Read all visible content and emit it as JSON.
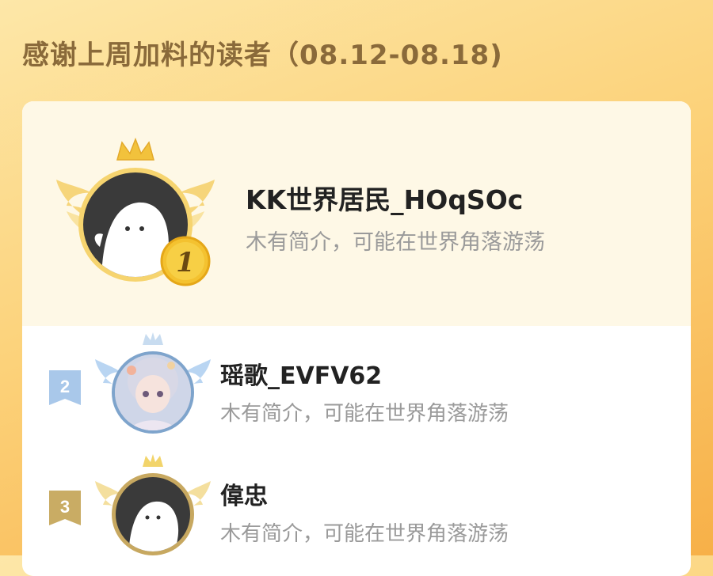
{
  "header": {
    "title": "感谢上周加料的读者（08.12-08.18)"
  },
  "ranking": [
    {
      "rank": "1",
      "name": "KK世界居民_HOqSOc",
      "bio": "木有简介，可能在世界角落游荡"
    },
    {
      "rank": "2",
      "name": "瑶歌_EVFV62",
      "bio": "木有简介，可能在世界角落游荡"
    },
    {
      "rank": "3",
      "name": "偉忠",
      "bio": "木有简介，可能在世界角落游荡"
    }
  ],
  "colors": {
    "gold": "#f2c23c",
    "silver_blue": "#9ec3ea",
    "bronze": "#c7a860",
    "avatar_bg": "#3a3a3a"
  },
  "icons": [
    "crown-icon",
    "wing-icon",
    "ghost-avatar-icon",
    "rank-medal-icon",
    "rank-ribbon-icon"
  ]
}
